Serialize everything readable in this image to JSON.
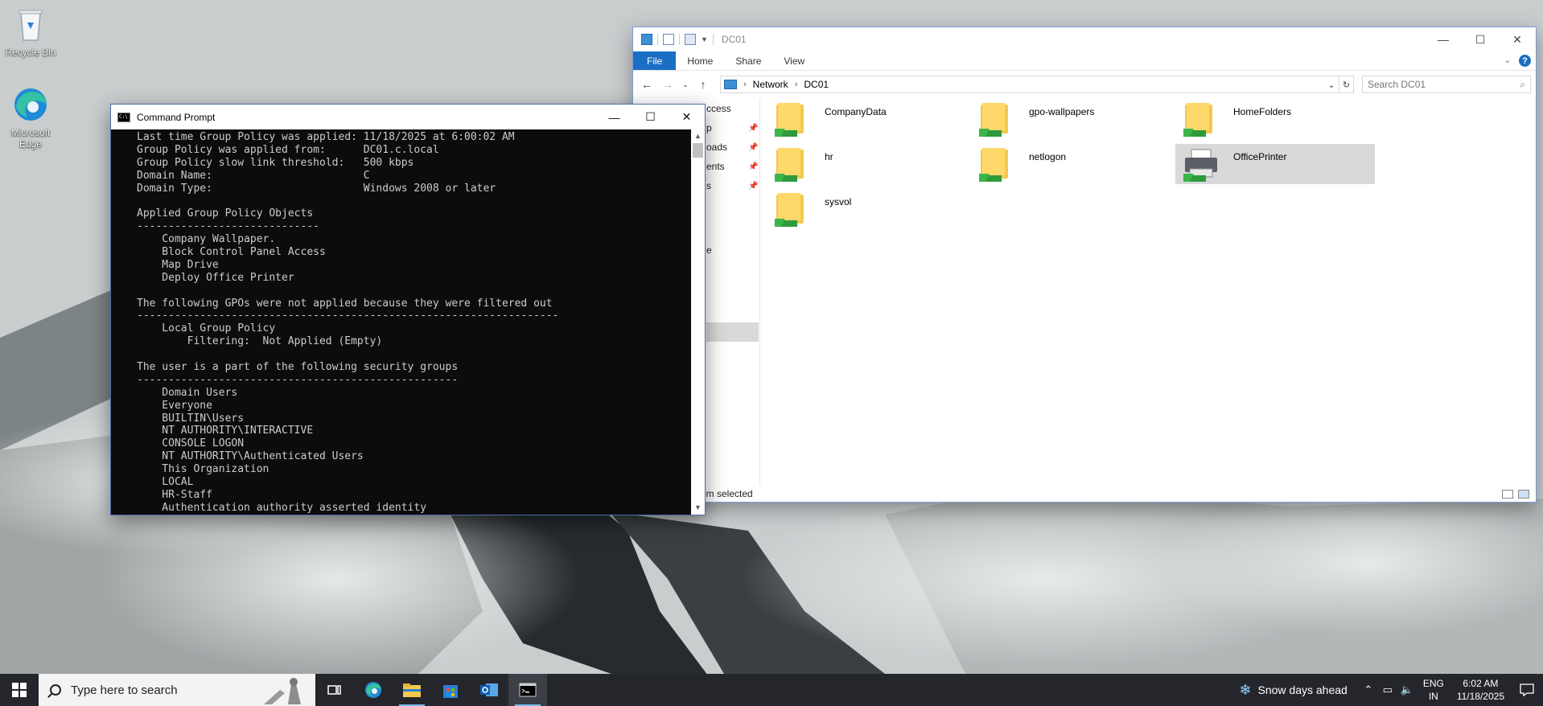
{
  "desktop": {
    "icons": [
      {
        "label": "Recycle Bin"
      },
      {
        "label": "Microsoft Edge"
      }
    ]
  },
  "cmd": {
    "title": "Command Prompt",
    "lines": [
      "Last time Group Policy was applied: 11/18/2025 at 6:00:02 AM",
      "Group Policy was applied from:      DC01.c.local",
      "Group Policy slow link threshold:   500 kbps",
      "Domain Name:                        C",
      "Domain Type:                        Windows 2008 or later",
      "",
      "Applied Group Policy Objects",
      "-----------------------------",
      "    Company Wallpaper.",
      "    Block Control Panel Access",
      "    Map Drive",
      "    Deploy Office Printer",
      "",
      "The following GPOs were not applied because they were filtered out",
      "-------------------------------------------------------------------",
      "    Local Group Policy",
      "        Filtering:  Not Applied (Empty)",
      "",
      "The user is a part of the following security groups",
      "---------------------------------------------------",
      "    Domain Users",
      "    Everyone",
      "    BUILTIN\\Users",
      "    NT AUTHORITY\\INTERACTIVE",
      "    CONSOLE LOGON",
      "    NT AUTHORITY\\Authenticated Users",
      "    This Organization",
      "    LOCAL",
      "    HR-Staff",
      "    Authentication authority asserted identity"
    ]
  },
  "explorer": {
    "title": "DC01",
    "tabs": [
      "File",
      "Home",
      "Share",
      "View"
    ],
    "breadcrumb": [
      "Network",
      "DC01"
    ],
    "search_placeholder": "Search DC01",
    "nav_partial": [
      "ccess",
      "p",
      "oads",
      "ents",
      "s",
      "e"
    ],
    "items": [
      {
        "name": "CompanyData",
        "type": "share"
      },
      {
        "name": "gpo-wallpapers",
        "type": "share"
      },
      {
        "name": "HomeFolders",
        "type": "share"
      },
      {
        "name": "hr",
        "type": "share"
      },
      {
        "name": "netlogon",
        "type": "share"
      },
      {
        "name": "OfficePrinter",
        "type": "printer",
        "selected": true
      },
      {
        "name": "sysvol",
        "type": "share"
      }
    ],
    "status": "em selected"
  },
  "taskbar": {
    "search_placeholder": "Type here to search",
    "weather": "Snow days ahead",
    "lang_line1": "ENG",
    "lang_line2": "IN",
    "time": "6:02 AM",
    "date": "11/18/2025"
  }
}
